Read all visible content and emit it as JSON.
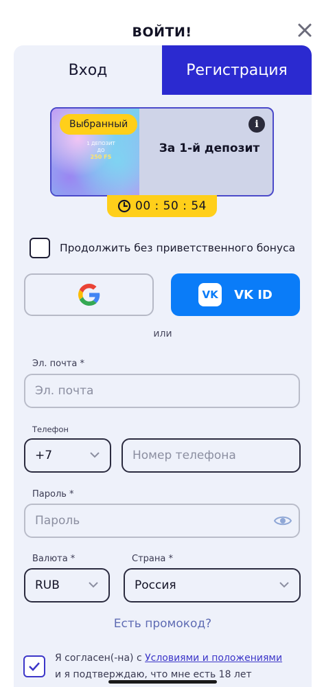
{
  "header": {
    "title": "ВОЙТИ!",
    "close_icon": "close-icon"
  },
  "tabs": [
    {
      "label": "Вход",
      "active": false
    },
    {
      "label": "Регистрация",
      "active": true
    }
  ],
  "bonus": {
    "badge": "Выбранный",
    "image_line1": "1 ДЕПОЗИТ",
    "image_line2": "ДО",
    "image_line3": "250 FS",
    "title": "За 1-й депозит",
    "info_icon": "info-icon",
    "timer": "00 : 50 : 54",
    "timer_icon": "clock-icon"
  },
  "no_bonus": {
    "label": "Продолжить без приветственного бонуса",
    "checked": false
  },
  "social": {
    "google_icon": "google-icon",
    "vk_label": "VK ID",
    "vk_logo_text": "VK",
    "or": "или"
  },
  "form": {
    "email_label": "Эл. почта *",
    "email_placeholder": "Эл. почта",
    "phone_label": "Телефон",
    "phone_code": "+7",
    "phone_placeholder": "Номер телефона",
    "password_label": "Пароль *",
    "password_placeholder": "Пароль",
    "currency_label": "Валюта *",
    "currency_value": "RUB",
    "country_label": "Страна *",
    "country_value": "Россия",
    "promo_link": "Есть промокод?"
  },
  "agreement": {
    "text_before": "Я согласен(-на) с ",
    "link": "Условиями и положениями",
    "text_after": "и я подтверждаю, что мне есть 18 лет",
    "checked": true
  },
  "colors": {
    "accent": "#2b2ad0",
    "vk_blue": "#0a7cf8",
    "yellow": "#ffcf1a",
    "card_bg": "#eef1fa"
  }
}
